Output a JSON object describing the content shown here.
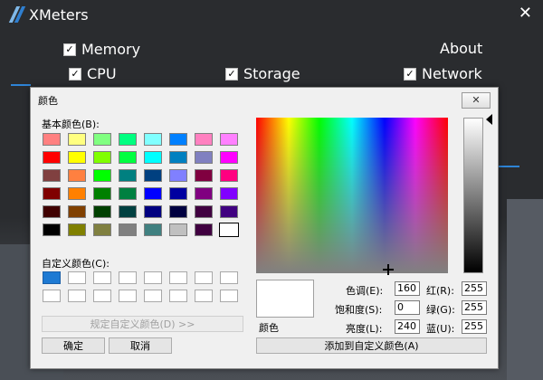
{
  "app": {
    "title": "XMeters",
    "close": "✕",
    "options": [
      {
        "label": "Memory",
        "checked": true
      },
      {
        "label": "CPU",
        "checked": true
      },
      {
        "label": "Storage",
        "checked": true
      },
      {
        "label": "Network",
        "checked": true
      }
    ],
    "about": "About",
    "accent": "#2e84d6"
  },
  "dialog": {
    "title": "颜色",
    "close": "✕",
    "basic_label": "基本颜色(B):",
    "custom_label": "自定义颜色(C):",
    "basic_colors": [
      [
        "#ff8080",
        "#ffff80",
        "#80ff80",
        "#00ff80",
        "#80ffff",
        "#0080ff",
        "#ff80c0",
        "#ff80ff"
      ],
      [
        "#ff0000",
        "#ffff00",
        "#80ff00",
        "#00ff40",
        "#00ffff",
        "#0080c0",
        "#8080c0",
        "#ff00ff"
      ],
      [
        "#804040",
        "#ff8040",
        "#00ff00",
        "#008080",
        "#004080",
        "#8080ff",
        "#800040",
        "#ff0080"
      ],
      [
        "#800000",
        "#ff8000",
        "#008000",
        "#008040",
        "#0000ff",
        "#0000a0",
        "#800080",
        "#8000ff"
      ],
      [
        "#400000",
        "#804000",
        "#004000",
        "#004040",
        "#000080",
        "#000040",
        "#400040",
        "#400080"
      ],
      [
        "#000000",
        "#808000",
        "#808040",
        "#808080",
        "#408080",
        "#c0c0c0",
        "#400040",
        "#ffffff"
      ]
    ],
    "custom_colors": [
      [
        "#1e7ad3",
        "#ffffff",
        "#ffffff",
        "#ffffff",
        "#ffffff",
        "#ffffff",
        "#ffffff",
        "#ffffff"
      ],
      [
        "#ffffff",
        "#ffffff",
        "#ffffff",
        "#ffffff",
        "#ffffff",
        "#ffffff",
        "#ffffff",
        "#ffffff"
      ]
    ],
    "define_custom": "规定自定义颜色(D) >>",
    "ok": "确定",
    "cancel": "取消",
    "preview_label": "颜色",
    "hue_label": "色调(E):",
    "hue": "160",
    "sat_label": "饱和度(S):",
    "sat": "0",
    "lum_label": "亮度(L):",
    "lum": "240",
    "red_label": "红(R):",
    "red": "255",
    "green_label": "绿(G):",
    "green": "255",
    "blue_label": "蓝(U):",
    "blue": "255",
    "add_custom": "添加到自定义颜色(A)"
  }
}
